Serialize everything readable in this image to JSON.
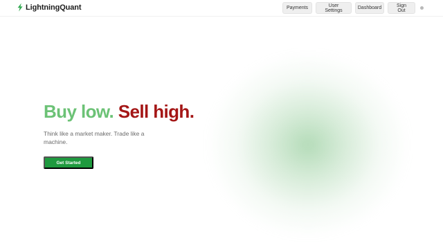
{
  "brand": {
    "name": "LightningQuant",
    "logo_icon": "lightning-bolt-icon",
    "accent": "#2fa84f"
  },
  "nav": {
    "payments": "Payments",
    "user_settings": "User Settings",
    "dashboard": "Dashboard",
    "sign_out": "Sign Out",
    "theme_toggle_icon": "circle-dot-icon"
  },
  "hero": {
    "title_part1": "Buy low.",
    "title_part2": "Sell high.",
    "title_part1_color": "#6cc276",
    "title_part2_color": "#a41616",
    "subtitle": "Think like a market maker. Trade like a machine.",
    "cta_label": "Get Started",
    "cta_color": "#1f9a3f"
  }
}
